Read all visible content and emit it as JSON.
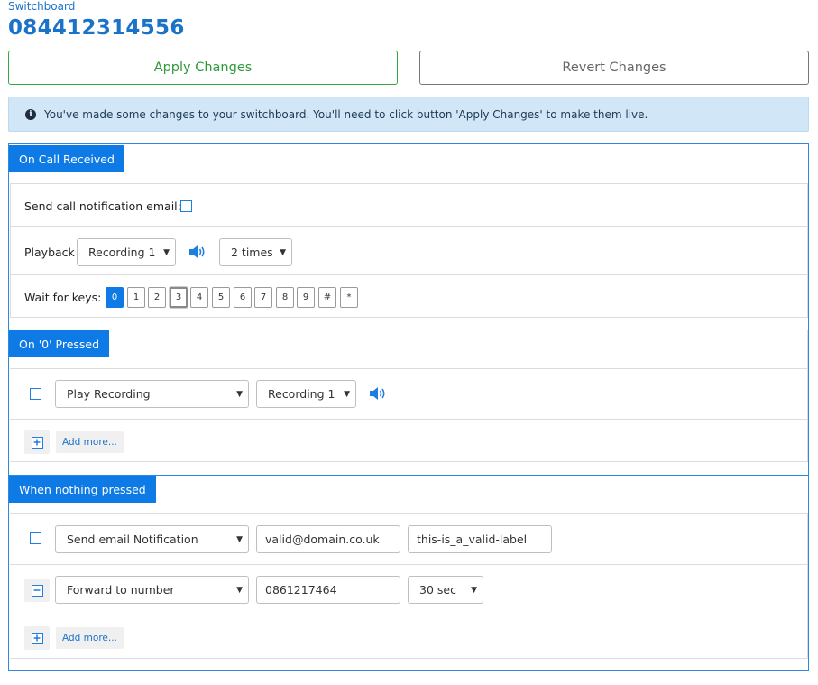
{
  "header": {
    "breadcrumb": "Switchboard",
    "number": "084412314556"
  },
  "actions": {
    "apply_label": "Apply Changes",
    "revert_label": "Revert Changes"
  },
  "alert": {
    "icon": "info-icon",
    "text": "You've made some changes to your switchboard. You'll need to click button 'Apply Changes' to make them live."
  },
  "on_call_received": {
    "title": "On Call Received",
    "notify_label": "Send call notification email:",
    "notify_checked": false,
    "playback_label": "Playback",
    "playback_recording": "Recording 1",
    "playback_times": "2 times",
    "wait_label": "Wait for keys:",
    "keys": [
      "0",
      "1",
      "2",
      "3",
      "4",
      "5",
      "6",
      "7",
      "8",
      "9",
      "#",
      "*"
    ],
    "active_key": "0",
    "focused_key": "3"
  },
  "on_0_pressed": {
    "title": "On '0' Pressed",
    "row": {
      "action": "Play Recording",
      "recording": "Recording 1"
    },
    "add_more_label": "Add more..."
  },
  "when_nothing_pressed": {
    "title": "When nothing pressed",
    "row1": {
      "action": "Send email Notification",
      "email": "valid@domain.co.uk",
      "label": "this-is_a_valid-label"
    },
    "row2": {
      "action": "Forward to number",
      "number": "0861217464",
      "timeout": "30 sec"
    },
    "add_more_label": "Add more..."
  },
  "colors": {
    "accent": "#0e7ae6",
    "success": "#35a843",
    "alert_bg": "#d1e7f8"
  }
}
